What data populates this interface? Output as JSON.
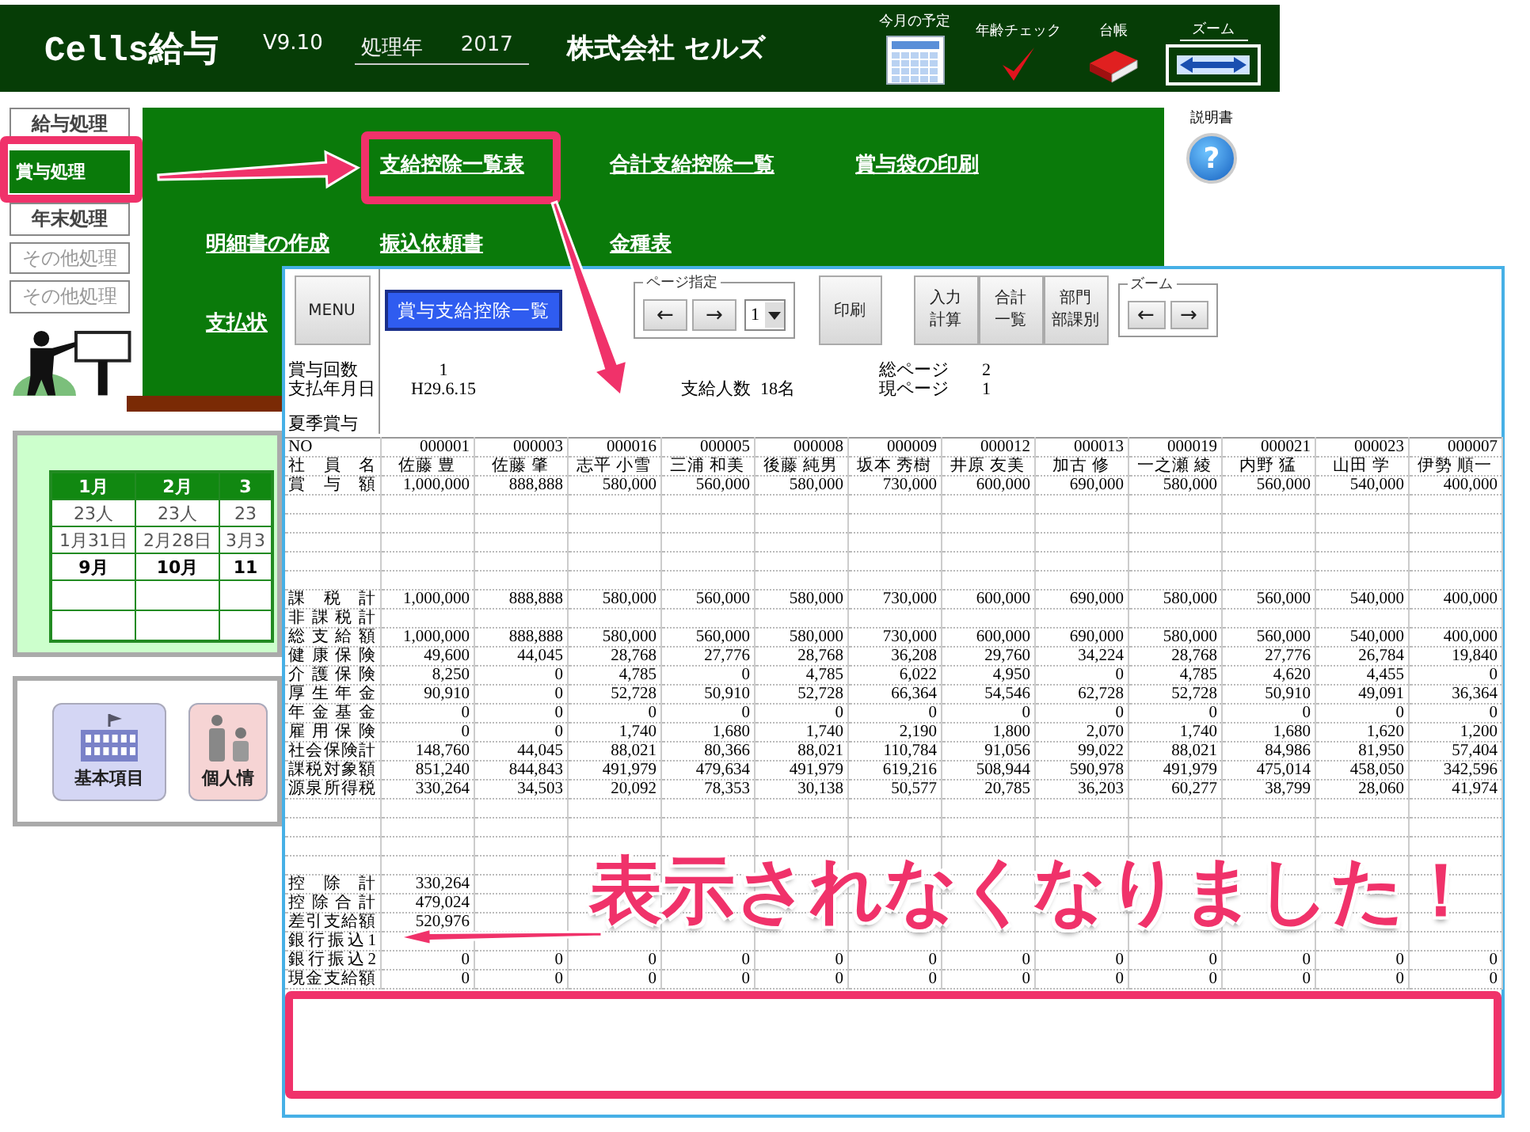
{
  "header": {
    "app_title": "Cells給与",
    "version": "V9.10",
    "year_label": "処理年",
    "year": "2017",
    "company": "株式会社 セルズ",
    "tools": [
      {
        "kind": "calendar",
        "label": "今月の予定"
      },
      {
        "kind": "check",
        "label": "年齢チェック"
      },
      {
        "kind": "ledger",
        "label": "台帳"
      },
      {
        "kind": "zoom",
        "label": "ズーム"
      }
    ]
  },
  "menu": [
    {
      "label": "給与処理",
      "selected": false,
      "disabled": false
    },
    {
      "label": "賞与処理",
      "selected": true,
      "disabled": false
    },
    {
      "label": "年末処理",
      "selected": false,
      "disabled": false
    },
    {
      "label": "その他処理",
      "selected": false,
      "disabled": true
    },
    {
      "label": "その他処理",
      "selected": false,
      "disabled": true
    }
  ],
  "panel": {
    "rows": [
      [
        "",
        "支給控除一覧表",
        "合計支給控除一覧",
        "賞与袋の印刷"
      ],
      [
        "明細書の作成",
        "振込依頼書",
        "金種表"
      ],
      [
        "支払状"
      ]
    ]
  },
  "manual": {
    "label": "説明書",
    "icon": "?"
  },
  "calendar": {
    "columns": [
      {
        "month": "1月",
        "count": "23人",
        "date": "1月31日",
        "next": "9月"
      },
      {
        "month": "2月",
        "count": "23人",
        "date": "2月28日",
        "next": "10月"
      },
      {
        "month": "3",
        "count": "23",
        "date": "3月3",
        "next": "11"
      }
    ]
  },
  "shortcuts": [
    {
      "kind": "building",
      "label": "基本項目"
    },
    {
      "kind": "people",
      "label": "個人情"
    }
  ],
  "sheet": {
    "menu_button": "MENU",
    "title_button": "賞与支給控除一覧",
    "page_group": {
      "legend": "ページ指定",
      "prev": "←",
      "next": "→",
      "page": "1"
    },
    "print_button": "印刷",
    "actions": [
      {
        "lines": [
          "入力",
          "計算"
        ]
      },
      {
        "lines": [
          "合計",
          "一覧"
        ]
      },
      {
        "lines": [
          "部門",
          "部課別"
        ]
      }
    ],
    "zoom_group": {
      "legend": "ズーム",
      "prev": "←",
      "next": "→"
    },
    "info": {
      "bonus_count_label": "賞与回数",
      "bonus_count": "1",
      "pay_date_label": "支払年月日",
      "pay_date": "H29.6.15",
      "payees_label": "支給人数",
      "payees": "18名",
      "total_pages_label": "総ページ",
      "total_pages": "2",
      "current_page_label": "現ページ",
      "current_page": "1",
      "section": "夏季賞与"
    },
    "table": {
      "rows": [
        {
          "kind": "ids",
          "label": "NO",
          "values": [
            "000001",
            "000003",
            "000016",
            "000005",
            "000008",
            "000009",
            "000012",
            "000013",
            "000019",
            "000021",
            "000023",
            "000007"
          ]
        },
        {
          "kind": "names",
          "label": "社員名",
          "values": [
            "佐藤 豊",
            "佐藤 肇",
            "志平 小雪",
            "三浦 和美",
            "後藤 純男",
            "坂本 秀樹",
            "井原 友美",
            "加古 修",
            "一之瀬 綾",
            "内野 猛",
            "山田 学",
            "伊勢 順一"
          ]
        },
        {
          "kind": "amount",
          "label": "賞与額",
          "values": [
            "1,000,000",
            "888,888",
            "580,000",
            "560,000",
            "580,000",
            "730,000",
            "600,000",
            "690,000",
            "580,000",
            "560,000",
            "540,000",
            "400,000"
          ]
        },
        {
          "kind": "blank"
        },
        {
          "kind": "blank"
        },
        {
          "kind": "blank"
        },
        {
          "kind": "blank"
        },
        {
          "kind": "blank"
        },
        {
          "kind": "amount",
          "label": "課税計",
          "values": [
            "1,000,000",
            "888,888",
            "580,000",
            "560,000",
            "580,000",
            "730,000",
            "600,000",
            "690,000",
            "580,000",
            "560,000",
            "540,000",
            "400,000"
          ]
        },
        {
          "kind": "amount",
          "label": "非課税計"
        },
        {
          "kind": "amount",
          "label": "総支給額",
          "values": [
            "1,000,000",
            "888,888",
            "580,000",
            "560,000",
            "580,000",
            "730,000",
            "600,000",
            "690,000",
            "580,000",
            "560,000",
            "540,000",
            "400,000"
          ]
        },
        {
          "kind": "amount",
          "label": "健康保険",
          "values": [
            "49,600",
            "44,045",
            "28,768",
            "27,776",
            "28,768",
            "36,208",
            "29,760",
            "34,224",
            "28,768",
            "27,776",
            "26,784",
            "19,840"
          ]
        },
        {
          "kind": "amount",
          "label": "介護保険",
          "values": [
            "8,250",
            "0",
            "4,785",
            "0",
            "4,785",
            "6,022",
            "4,950",
            "0",
            "4,785",
            "4,620",
            "4,455",
            "0"
          ]
        },
        {
          "kind": "amount",
          "label": "厚生年金",
          "values": [
            "90,910",
            "0",
            "52,728",
            "50,910",
            "52,728",
            "66,364",
            "54,546",
            "62,728",
            "52,728",
            "50,910",
            "49,091",
            "36,364"
          ]
        },
        {
          "kind": "amount",
          "label": "年金基金",
          "values": [
            "0",
            "0",
            "0",
            "0",
            "0",
            "0",
            "0",
            "0",
            "0",
            "0",
            "0",
            "0"
          ]
        },
        {
          "kind": "amount",
          "label": "雇用保険",
          "values": [
            "0",
            "0",
            "1,740",
            "1,680",
            "1,740",
            "2,190",
            "1,800",
            "2,070",
            "1,740",
            "1,680",
            "1,620",
            "1,200"
          ]
        },
        {
          "kind": "amount",
          "label": "社会保険計",
          "values": [
            "148,760",
            "44,045",
            "88,021",
            "80,366",
            "88,021",
            "110,784",
            "91,056",
            "99,022",
            "88,021",
            "84,986",
            "81,950",
            "57,404"
          ]
        },
        {
          "kind": "amount",
          "label": "課税対象額",
          "values": [
            "851,240",
            "844,843",
            "491,979",
            "479,634",
            "491,979",
            "619,216",
            "508,944",
            "590,978",
            "491,979",
            "475,014",
            "458,050",
            "342,596"
          ]
        },
        {
          "kind": "amount",
          "label": "源泉所得税",
          "values": [
            "330,264",
            "34,503",
            "20,092",
            "78,353",
            "30,138",
            "50,577",
            "20,785",
            "36,203",
            "60,277",
            "38,799",
            "28,060",
            "41,974"
          ]
        },
        {
          "kind": "blank"
        },
        {
          "kind": "blank"
        },
        {
          "kind": "blank"
        },
        {
          "kind": "blank"
        },
        {
          "kind": "amount",
          "label": "控除計",
          "values": [
            "330,264"
          ]
        },
        {
          "kind": "amount",
          "label": "控除合計",
          "values": [
            "479,024"
          ]
        },
        {
          "kind": "amount",
          "label": "差引支給額",
          "values": [
            "520,976"
          ]
        },
        {
          "kind": "amount",
          "label": "銀行振込1"
        },
        {
          "kind": "amount",
          "label": "銀行振込2",
          "values": [
            "0",
            "0",
            "0",
            "0",
            "0",
            "0",
            "0",
            "0",
            "0",
            "0",
            "0",
            "0"
          ]
        },
        {
          "kind": "amount",
          "label": "現金支給額",
          "values": [
            "0",
            "0",
            "0",
            "0",
            "0",
            "0",
            "0",
            "0",
            "0",
            "0",
            "0",
            "0"
          ]
        }
      ]
    }
  },
  "annotation": {
    "message": "表示されなくなりました！"
  }
}
